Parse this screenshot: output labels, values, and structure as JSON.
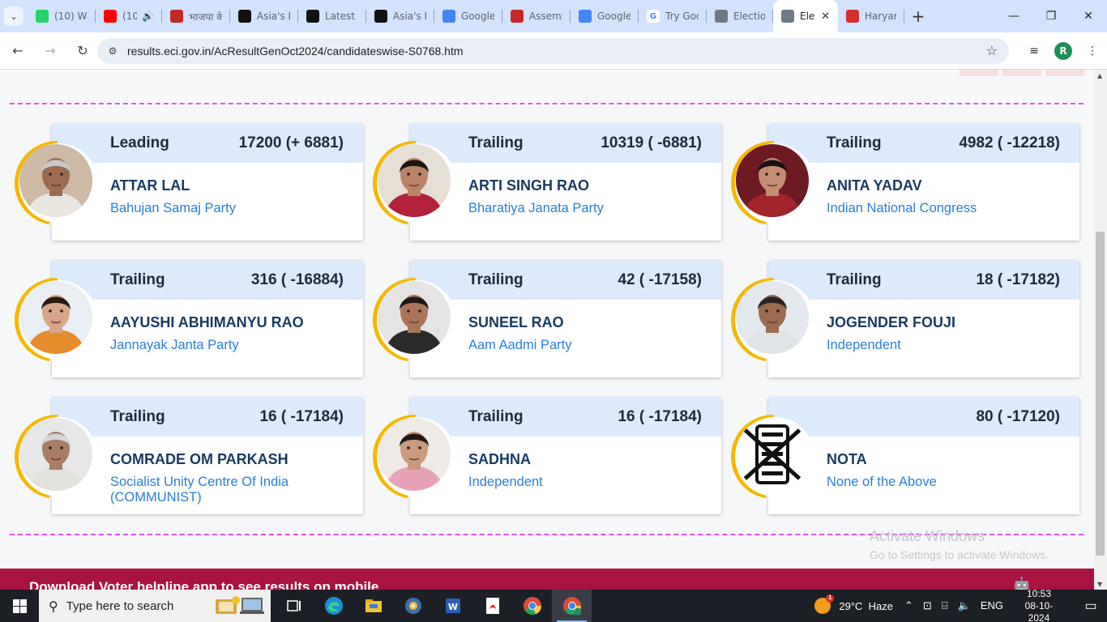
{
  "browser": {
    "tabs": [
      {
        "label": "(10) Wh",
        "favicon": "whatsapp-icon",
        "color": "#25d366"
      },
      {
        "label": "(10",
        "favicon": "youtube-icon",
        "color": "#ff0000",
        "audio": "🔊"
      },
      {
        "label": "भाजपा के",
        "favicon": "news-icon",
        "color": "#c62828"
      },
      {
        "label": "Asia's P",
        "favicon": "x-icon",
        "color": "#111111"
      },
      {
        "label": "Latest I",
        "favicon": "x-icon",
        "color": "#111111"
      },
      {
        "label": "Asia's P",
        "favicon": "x-icon",
        "color": "#111111"
      },
      {
        "label": "Google",
        "favicon": "google-translate-icon",
        "color": "#4285f4"
      },
      {
        "label": "Assemb",
        "favicon": "news-icon",
        "color": "#c62828"
      },
      {
        "label": "Google",
        "favicon": "google-translate-icon",
        "color": "#4285f4"
      },
      {
        "label": "Try Goo",
        "favicon": "google-icon",
        "color": "#ffffff"
      },
      {
        "label": "Election",
        "favicon": "eci-icon",
        "color": "#6f7a85"
      },
      {
        "label": "Ele",
        "favicon": "eci-icon",
        "color": "#6f7a85",
        "active": true,
        "close": "✕"
      },
      {
        "label": "Haryan",
        "favicon": "amar-ujala-icon",
        "color": "#d32f2f"
      }
    ],
    "new_tab": "+",
    "window": {
      "minimize": "—",
      "restore": "❐",
      "close": "✕"
    },
    "url": "results.eci.gov.in/AcResultGenOct2024/candidateswise-S0768.htm",
    "profile_initial": "R"
  },
  "candidates": [
    {
      "status": "Leading",
      "votes": "17200 (+ 6881)",
      "name": "ATTAR LAL",
      "party": "Bahujan Samaj Party",
      "photo": {
        "bg": "#cdb9a4",
        "skin": "#9a6b4f",
        "hair": "#c9c9c9",
        "shirt": "#e9e6df"
      }
    },
    {
      "status": "Trailing",
      "votes": "10319 ( -6881)",
      "name": "ARTI SINGH RAO",
      "party": "Bharatiya Janata Party",
      "photo": {
        "bg": "#e6dfd6",
        "skin": "#b98466",
        "hair": "#1e1512",
        "shirt": "#b3223a"
      }
    },
    {
      "status": "Trailing",
      "votes": "4982 ( -12218)",
      "name": "ANITA YADAV",
      "party": "Indian National Congress",
      "photo": {
        "bg": "#6e1a23",
        "skin": "#c18e72",
        "hair": "#1b1210",
        "shirt": "#a0242a"
      }
    },
    {
      "status": "Trailing",
      "votes": "316 ( -16884)",
      "name": "AAYUSHI ABHIMANYU RAO",
      "party": "Jannayak Janta Party",
      "photo": {
        "bg": "#e9eef2",
        "skin": "#d5a688",
        "hair": "#2a1a14",
        "shirt": "#e58c2d"
      }
    },
    {
      "status": "Trailing",
      "votes": "42 ( -17158)",
      "name": "SUNEEL RAO",
      "party": "Aam Aadmi Party",
      "photo": {
        "bg": "#e4e4e4",
        "skin": "#a97658",
        "hair": "#1e1916",
        "shirt": "#2b2b2b"
      }
    },
    {
      "status": "Trailing",
      "votes": "18 ( -17182)",
      "name": "JOGENDER FOUJI",
      "party": "Independent",
      "photo": {
        "bg": "#e3e8ee",
        "skin": "#9c6b4d",
        "hair": "#2a2420",
        "shirt": "#dfe3e6"
      }
    },
    {
      "status": "Trailing",
      "votes": "16 ( -17184)",
      "name": "COMRADE OM PARKASH",
      "party": "Socialist Unity Centre Of India (COMMUNIST)",
      "photo": {
        "bg": "#e7e7e7",
        "skin": "#a87e66",
        "hair": "#d4d4d4",
        "shirt": "#e3e1dc"
      }
    },
    {
      "status": "Trailing",
      "votes": "16 ( -17184)",
      "name": "SADHNA",
      "party": "Independent",
      "photo": {
        "bg": "#eeeae6",
        "skin": "#c99a7c",
        "hair": "#241813",
        "shirt": "#e6a3b8"
      }
    },
    {
      "status": "",
      "votes": "80 ( -17120)",
      "name": "NOTA",
      "party": "None of the Above",
      "nota": true
    }
  ],
  "watermark": {
    "title": "Activate Windows",
    "subtitle": "Go to Settings to activate Windows."
  },
  "banner": {
    "text": "Download Voter helpline app to see results on mobile",
    "icons": "🤖"
  },
  "taskbar": {
    "search_placeholder": "Type here to search",
    "apps": [
      "task-view-icon",
      "edge-icon",
      "file-explorer-icon",
      "media-icon",
      "word-icon",
      "pdf-icon",
      "chrome-icon",
      "chrome-profile-icon"
    ],
    "weather": {
      "temp": "29°C",
      "condition": "Haze",
      "alert": "1"
    },
    "lang": "ENG",
    "time": "10:53",
    "date": "08-10-2024"
  }
}
